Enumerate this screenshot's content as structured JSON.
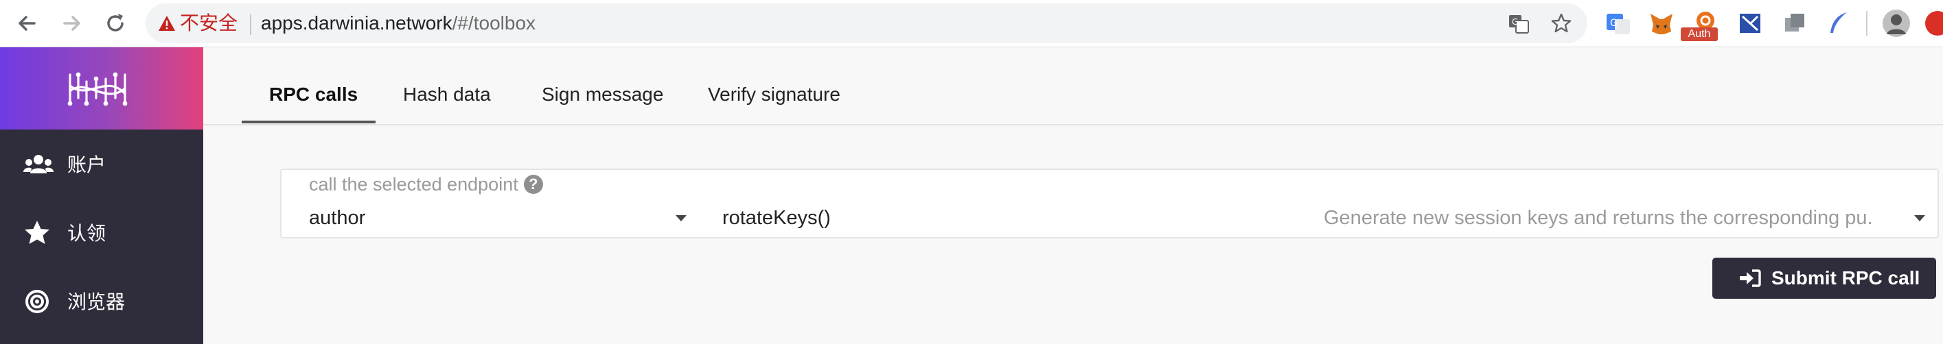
{
  "browser": {
    "security_label": "不安全",
    "url_host": "apps.darwinia.network",
    "url_path": "/#/toolbox",
    "extension_badge": "Auth"
  },
  "sidebar": {
    "items": [
      {
        "label": "账户",
        "icon": "users-icon"
      },
      {
        "label": "认领",
        "icon": "star-icon"
      },
      {
        "label": "浏览器",
        "icon": "target-icon"
      }
    ]
  },
  "tabs": [
    {
      "label": "RPC calls",
      "active": true
    },
    {
      "label": "Hash data",
      "active": false
    },
    {
      "label": "Sign message",
      "active": false
    },
    {
      "label": "Verify signature",
      "active": false
    }
  ],
  "rpc": {
    "field_label": "call the selected endpoint",
    "help_glyph": "?",
    "section": "author",
    "method": "rotateKeys()",
    "description": "Generate new session keys and returns the corresponding pu..."
  },
  "submit": {
    "label": "Submit RPC call"
  },
  "colors": {
    "sidebar_bg": "#2f2d3b",
    "brand_gradient_start": "#6f3be2",
    "brand_gradient_end": "#e2427c",
    "button_bg": "#2f2d3b"
  }
}
